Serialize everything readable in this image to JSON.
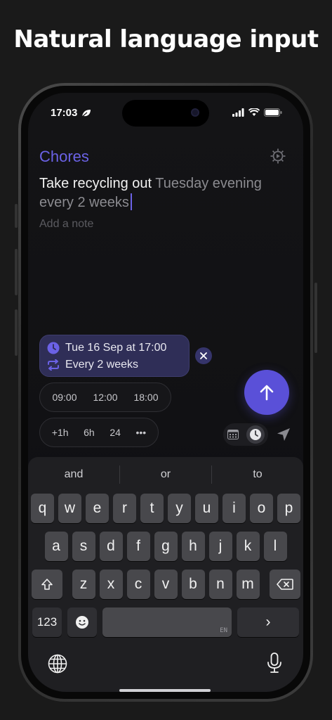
{
  "headline": "Natural language input",
  "status": {
    "time": "17:03"
  },
  "list_title": "Chores",
  "task": {
    "text": "Take recycling out",
    "parsed": "Tuesday evening every 2 weeks"
  },
  "note_placeholder": "Add a note",
  "schedule": {
    "date": "Tue 16 Sep at 17:00",
    "repeat": "Every 2 weeks"
  },
  "quick_times": [
    "09:00",
    "12:00",
    "18:00"
  ],
  "offsets": [
    "+1h",
    "6h",
    "24",
    "•••"
  ],
  "keyboard": {
    "suggestions": [
      "and",
      "or",
      "to"
    ],
    "row1": [
      "q",
      "w",
      "e",
      "r",
      "t",
      "y",
      "u",
      "i",
      "o",
      "p"
    ],
    "row2": [
      "a",
      "s",
      "d",
      "f",
      "g",
      "h",
      "j",
      "k",
      "l"
    ],
    "row3": [
      "z",
      "x",
      "c",
      "v",
      "b",
      "n",
      "m"
    ],
    "mode_key": "123",
    "space_lang": "EN",
    "return_glyph": "›"
  },
  "colors": {
    "accent": "#6b62e6",
    "send": "#5a50d8",
    "chip_bg": "#2f2e57"
  },
  "icons": [
    "leaf-icon",
    "signal-icon",
    "wifi-icon",
    "battery-icon",
    "gear-icon",
    "clock-icon",
    "repeat-icon",
    "close-icon",
    "arrow-up-icon",
    "calendar-icon",
    "location-arrow-icon",
    "shift-icon",
    "backspace-icon",
    "emoji-icon",
    "globe-icon",
    "mic-icon"
  ]
}
